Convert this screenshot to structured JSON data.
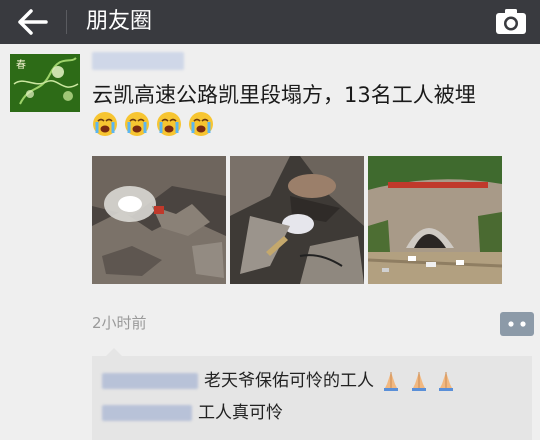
{
  "topbar": {
    "title": "朋友圈",
    "back_icon": "arrow-left-icon",
    "camera_icon": "camera-icon",
    "bg_color": "#393a3f"
  },
  "post": {
    "text": "云凯高速公路凯里段塌方，13名工人被埋",
    "emojis": [
      "crying-face",
      "crying-face",
      "crying-face",
      "crying-face"
    ],
    "time": "2小时前",
    "images": [
      "rescue-scene-1",
      "rescue-scene-2",
      "tunnel-collapse-site"
    ]
  },
  "comments": [
    {
      "text": "老天爷保佑可怜的工人",
      "emojis": [
        "folded-hands",
        "folded-hands",
        "folded-hands"
      ]
    },
    {
      "text": "工人真可怜"
    }
  ]
}
